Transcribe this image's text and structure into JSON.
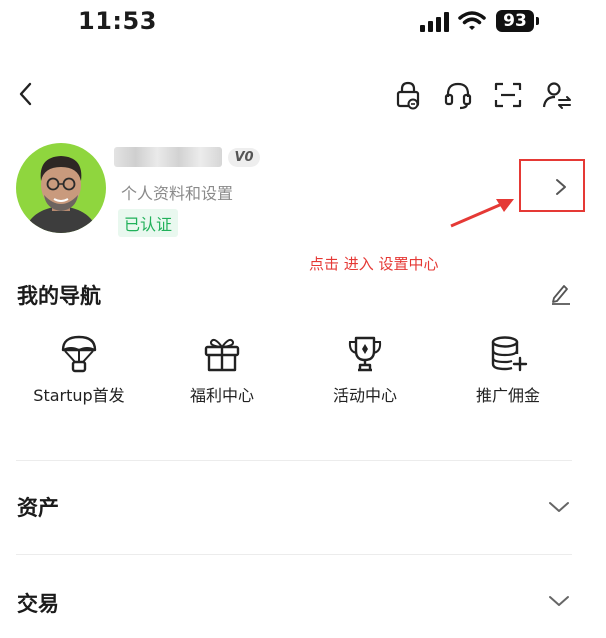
{
  "status_bar": {
    "time": "11:53",
    "battery": "93"
  },
  "profile": {
    "username": "username",
    "vip_level": "V0",
    "settings_label": "个人资料和设置",
    "verified_label": "已认证"
  },
  "annotation": {
    "note": "点击 进入 设置中心",
    "color": "#e53935"
  },
  "navigation": {
    "title": "我的导航",
    "items": [
      {
        "label": "Startup首发",
        "icon": "parachute-icon"
      },
      {
        "label": "福利中心",
        "icon": "gift-icon"
      },
      {
        "label": "活动中心",
        "icon": "trophy-icon"
      },
      {
        "label": "推广佣金",
        "icon": "coins-plus-icon"
      }
    ]
  },
  "sections": [
    {
      "title": "资产"
    },
    {
      "title": "交易"
    }
  ],
  "colors": {
    "accent_green": "#21b15a",
    "avatar_bg": "#8fd63e"
  }
}
